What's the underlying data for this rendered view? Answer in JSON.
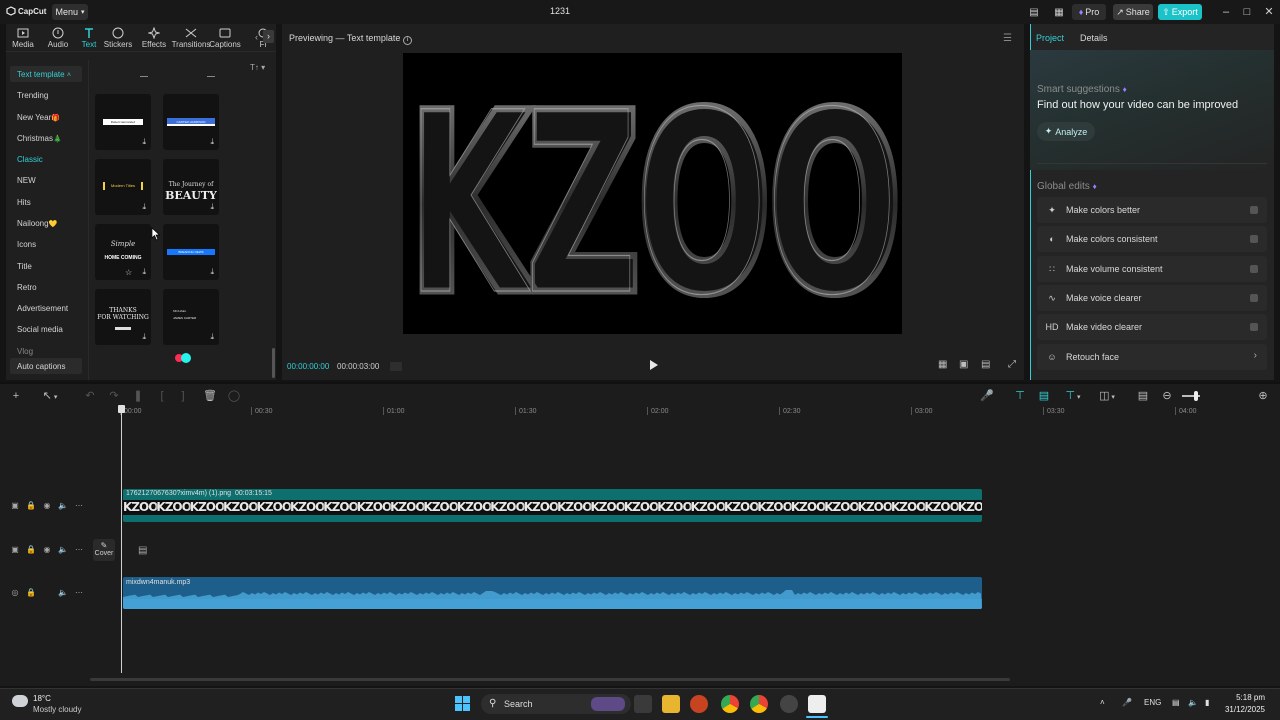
{
  "app": {
    "logo_text": "CapCut",
    "menu_label": "Menu",
    "window_title": "1231"
  },
  "titlebar": {
    "pro_label": "Pro",
    "share_label": "Share",
    "export_label": "Export"
  },
  "toolbar": [
    {
      "label": "Media",
      "icon": "media-icon"
    },
    {
      "label": "Audio",
      "icon": "audio-icon"
    },
    {
      "label": "Text",
      "icon": "text-icon"
    },
    {
      "label": "Stickers",
      "icon": "sticker-icon"
    },
    {
      "label": "Effects",
      "icon": "effects-icon"
    },
    {
      "label": "Transitions",
      "icon": "transitions-icon"
    },
    {
      "label": "Captions",
      "icon": "captions-icon"
    },
    {
      "label": "Fi",
      "icon": "filters-icon"
    }
  ],
  "categories": {
    "header": "Text template",
    "items": [
      "Trending",
      "New Year",
      "Christmas",
      "Classic",
      "NEW",
      "Hits",
      "Nailoong",
      "Icons",
      "Title",
      "Retro",
      "Advertisement",
      "Social media",
      "Vlog"
    ],
    "auto_captions": "Auto captions"
  },
  "templates": [
    {
      "top_text": "",
      "bottom_text": "Robert Hernandez"
    },
    {
      "top_text": "",
      "bottom_text": "CARTER HARRISON"
    },
    {
      "top_text": "",
      "bottom_text": "Modern Titles"
    },
    {
      "top_text": "The Journey of",
      "bottom_text": "BEAUTY"
    },
    {
      "top_text": "Simple",
      "bottom_text": "HOME COMING"
    },
    {
      "top_text": "LIVE",
      "bottom_text": "BREAKING NEWS"
    },
    {
      "top_text": "THANKS",
      "bottom_text": "FOR WATCHING"
    },
    {
      "top_text": "MICHAEL",
      "bottom_text": "JAMES CARTER"
    }
  ],
  "preview": {
    "title": "Previewing — Text template",
    "canvas_text": "KZOO",
    "current_time": "00:00:00:00",
    "total_time": "00:00:03:00"
  },
  "right_panel": {
    "tabs": [
      "Project",
      "Details"
    ],
    "smart_title": "Smart suggestions",
    "smart_text": "Find out how your video can be improved",
    "analyze_label": "Analyze",
    "global_title": "Global edits",
    "global_items": [
      {
        "label": "Make colors better",
        "icon": "magic-wand-icon"
      },
      {
        "label": "Make colors consistent",
        "icon": "color-match-icon"
      },
      {
        "label": "Make volume consistent",
        "icon": "volume-sliders-icon"
      },
      {
        "label": "Make voice clearer",
        "icon": "voice-wave-icon"
      },
      {
        "label": "Make video clearer",
        "icon": "hd-icon"
      },
      {
        "label": "Retouch face",
        "icon": "face-retouch-icon"
      }
    ]
  },
  "timeline": {
    "ruler": [
      "00:00",
      "00:30",
      "01:00",
      "01:30",
      "02:00",
      "02:30",
      "03:00",
      "03:30",
      "04:00"
    ],
    "video_clip_name": "1762127067630?ximv4m) (1).png",
    "video_clip_duration": "00:03:15:15",
    "video_clip_frame_text": "KZOO",
    "cover_label": "Cover",
    "audio_clip_name": "mixdwn4manuk.mp3"
  },
  "taskbar": {
    "weather_temp": "18°C",
    "weather_desc": "Mostly cloudy",
    "search_placeholder": "Search",
    "language": "ENG",
    "time": "5:18 pm",
    "date": "31/12/2025"
  },
  "colors": {
    "accent": "#1bc3c8",
    "video_clip": "#0e6f6f",
    "audio_clip": "#1e5e8a"
  }
}
